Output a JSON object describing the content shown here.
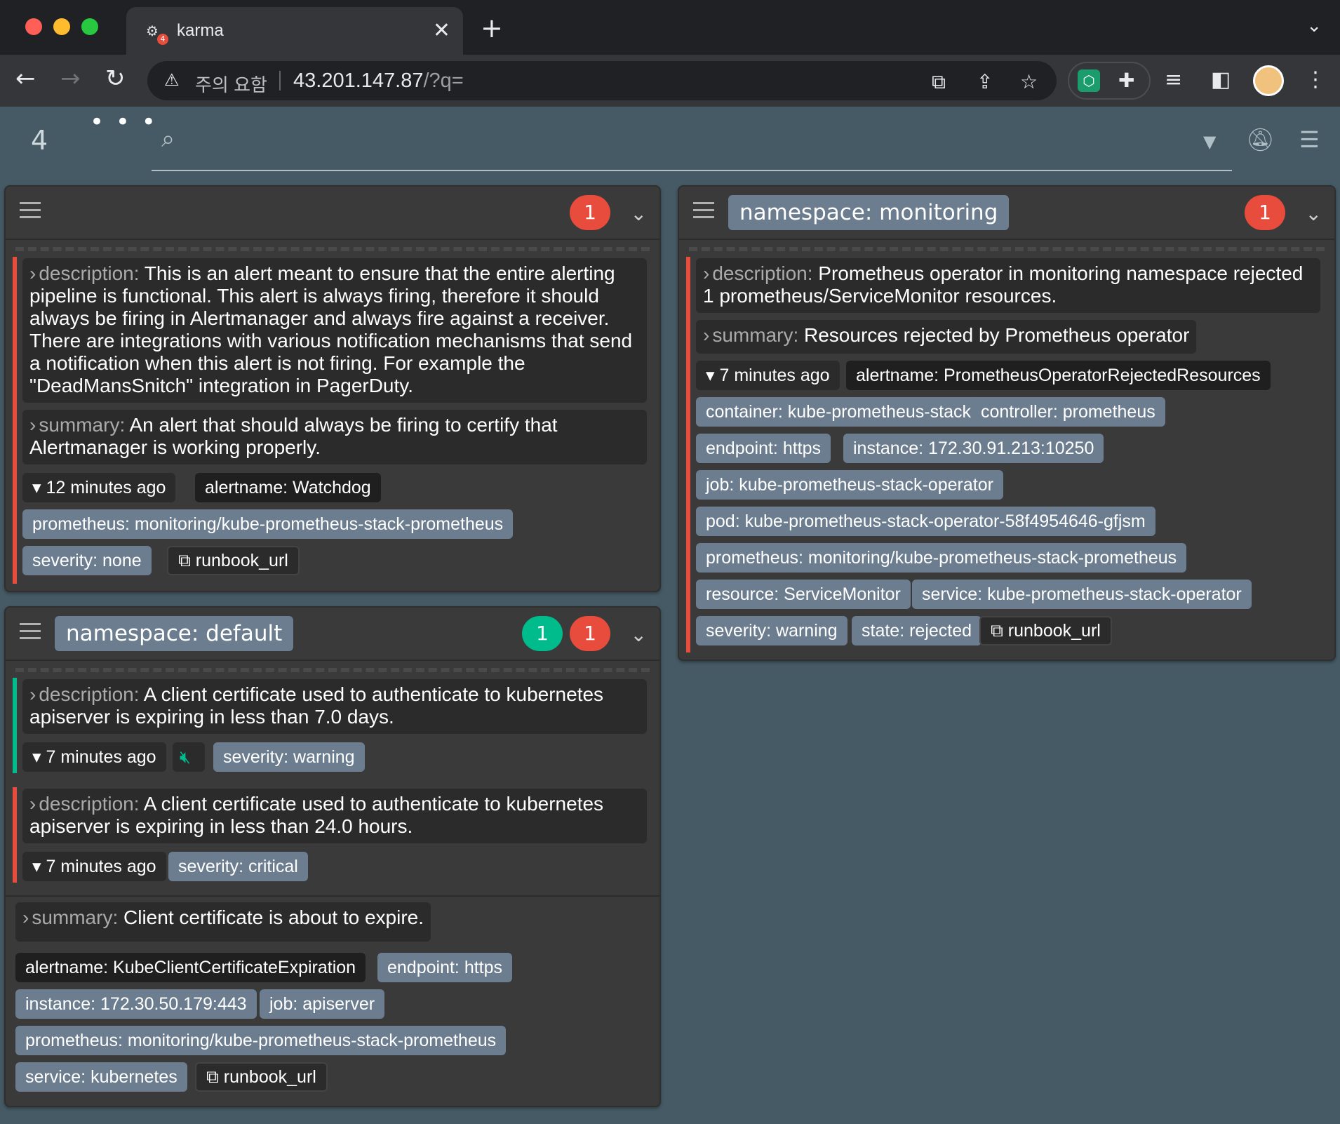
{
  "browser": {
    "tab_title": "karma",
    "tab_badge": "4",
    "security_warning": "주의 요함",
    "url_host": "43.201.147.87",
    "url_path": "/?q="
  },
  "navbar": {
    "alert_count": "4",
    "search_placeholder": ""
  },
  "groups": [
    {
      "namespace": "",
      "counts": [
        "1"
      ],
      "alerts": [
        {
          "state_color": "red",
          "annotations": [
            {
              "key": "description:",
              "value": "This is an alert meant to ensure that the entire alerting pipeline is functional. This alert is always firing, therefore it should always be firing in Alertmanager and always fire against a receiver. There are integrations with various notification mechanisms that send a notification when this alert is not firing. For example the \"DeadMansSnitch\" integration in PagerDuty."
            },
            {
              "key": "summary:",
              "value": "An alert that should always be firing to certify that Alertmanager is working properly."
            }
          ],
          "time": "12 minutes ago",
          "labels": [
            "alertname: Watchdog",
            "prometheus: monitoring/kube-prometheus-stack-prometheus",
            "severity: none"
          ],
          "link": "runbook_url"
        }
      ]
    },
    {
      "namespace": "namespace: default",
      "counts": [
        "1",
        "1"
      ],
      "alerts": [
        {
          "state_color": "green",
          "annotations": [
            {
              "key": "description:",
              "value": "A client certificate used to authenticate to kubernetes apiserver is expiring in less than 7.0 days."
            }
          ],
          "time": "7 minutes ago",
          "labels": [
            "severity: warning"
          ]
        },
        {
          "state_color": "red",
          "annotations": [
            {
              "key": "description:",
              "value": "A client certificate used to authenticate to kubernetes apiserver is expiring in less than 24.0 hours."
            }
          ],
          "time": "7 minutes ago",
          "labels": [
            "severity: critical"
          ]
        }
      ],
      "shared": {
        "summary_key": "summary:",
        "summary_value": "Client certificate is about to expire.",
        "labels": [
          "alertname: KubeClientCertificateExpiration",
          "endpoint: https",
          "instance: 172.30.50.179:443",
          "job: apiserver",
          "prometheus: monitoring/kube-prometheus-stack-prometheus",
          "service: kubernetes"
        ],
        "link": "runbook_url"
      }
    },
    {
      "namespace": "namespace: monitoring",
      "counts": [
        "1"
      ],
      "alerts": [
        {
          "state_color": "red",
          "annotations": [
            {
              "key": "description:",
              "value": "Prometheus operator in monitoring namespace rejected 1 prometheus/ServiceMonitor resources."
            },
            {
              "key": "summary:",
              "value": "Resources rejected by Prometheus operator"
            }
          ],
          "time": "7 minutes ago",
          "labels": [
            "alertname: PrometheusOperatorRejectedResources",
            "container: kube-prometheus-stack",
            "controller: prometheus",
            "endpoint: https",
            "instance: 172.30.91.213:10250",
            "job: kube-prometheus-stack-operator",
            "pod: kube-prometheus-stack-operator-58f4954646-gfjsm",
            "prometheus: monitoring/kube-prometheus-stack-prometheus",
            "resource: ServiceMonitor",
            "service: kube-prometheus-stack-operator",
            "severity: warning",
            "state: rejected"
          ],
          "link": "runbook_url"
        }
      ]
    }
  ],
  "colors": {
    "firing": "#e74c3c",
    "silenced": "#00bc8c",
    "label_bg": "#6b7d8f",
    "page_bg": "#455a64"
  }
}
